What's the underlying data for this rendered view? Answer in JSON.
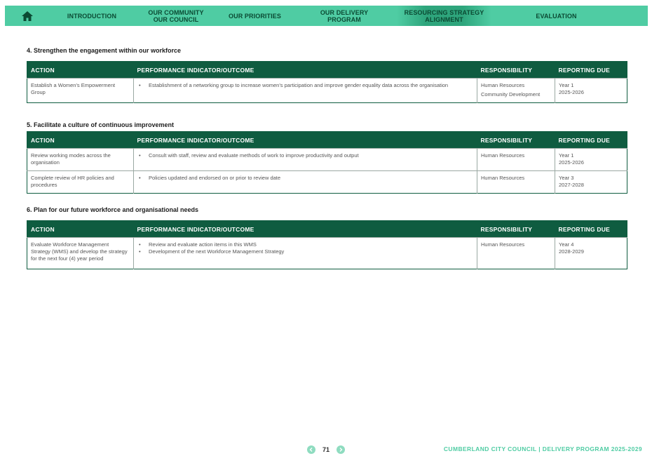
{
  "nav": {
    "tabs": [
      {
        "label": "INTRODUCTION"
      },
      {
        "label": "OUR COMMUNITY\nOUR COUNCIL"
      },
      {
        "label": "OUR PRIORITIES"
      },
      {
        "label": "OUR DELIVERY\nPROGRAM"
      },
      {
        "label": "RESOURCING STRATEGY\nALIGNMENT"
      },
      {
        "label": "EVALUATION"
      }
    ],
    "home_icon": "home-icon",
    "accent": "#4fcca3"
  },
  "headers": {
    "action": "ACTION",
    "indicator": "PERFORMANCE INDICATOR/OUTCOME",
    "responsibility": "RESPONSIBILITY",
    "reporting": "REPORTING DUE"
  },
  "sections": [
    {
      "title": "4.  Strengthen the engagement within our workforce",
      "rows": [
        {
          "action": "Establish a Women's Empowerment Group",
          "indicators": [
            "Establishment of a networking group to increase women's participation and improve gender equality data across the organisation"
          ],
          "responsibility": [
            "Human Resources",
            "Community Development"
          ],
          "reporting": [
            "Year 1",
            "2025-2026"
          ]
        }
      ]
    },
    {
      "title": "5.  Facilitate a culture of continuous improvement",
      "rows": [
        {
          "action": "Review working modes across the organisation",
          "indicators": [
            "Consult with staff, review and evaluate methods of work to improve productivity and output"
          ],
          "responsibility": [
            "Human Resources"
          ],
          "reporting": [
            "Year 1",
            "2025-2026"
          ]
        },
        {
          "action": "Complete review of HR policies and procedures",
          "indicators": [
            "Policies updated and endorsed on or prior to review date"
          ],
          "responsibility": [
            "Human Resources"
          ],
          "reporting": [
            "Year 3",
            "2027-2028"
          ]
        }
      ]
    },
    {
      "title": "6.  Plan for our future workforce and organisational needs",
      "rows": [
        {
          "action": "Evaluate Workforce Management Strategy (WMS) and develop the strategy for the next four (4) year period",
          "indicators": [
            "Review and evaluate action items in this WMS",
            "Development of the next Workforce Management Strategy"
          ],
          "responsibility": [
            "Human Resources"
          ],
          "reporting": [
            "Year 4",
            "2028-2029"
          ]
        }
      ]
    }
  ],
  "footer": {
    "page": "71",
    "brand": "CUMBERLAND CITY COUNCIL  |  DELIVERY PROGRAM 2025-2029"
  }
}
